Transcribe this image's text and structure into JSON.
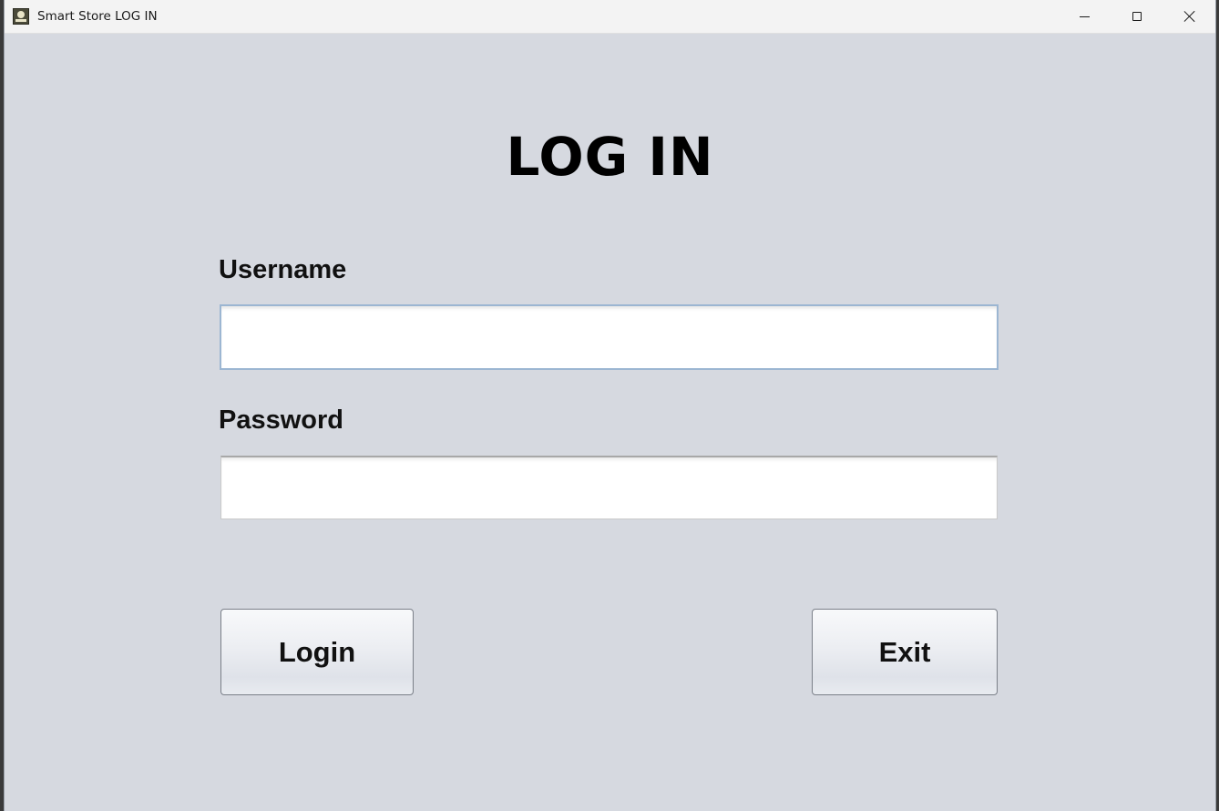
{
  "window": {
    "title": "Smart Store LOG IN",
    "icon": "app-icon"
  },
  "controls": {
    "minimize": "minimize-icon",
    "maximize": "maximize-icon",
    "close": "close-icon"
  },
  "form": {
    "heading": "LOG IN",
    "username_label": "Username",
    "username_value": "",
    "password_label": "Password",
    "password_value": ""
  },
  "buttons": {
    "login": "Login",
    "exit": "Exit"
  },
  "colors": {
    "background": "#d6d9e0",
    "titlebar": "#f3f3f3",
    "focus_border": "#9cb6d2"
  }
}
